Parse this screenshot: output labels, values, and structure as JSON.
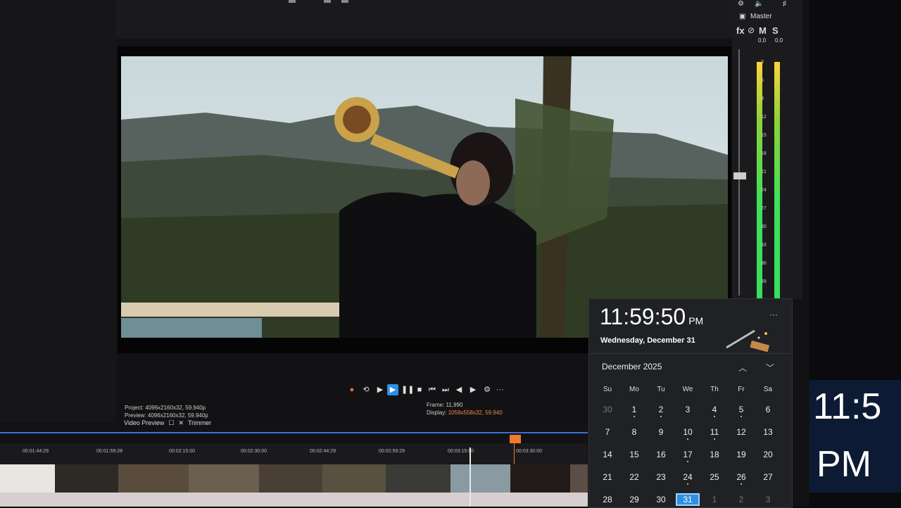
{
  "preview": {
    "project": "Project: 4096x2160x32, 59.940p",
    "preview_res": "Preview: 4096x2160x32, 59.940p",
    "frame": "Frame: 11,990",
    "display_label": "Display:",
    "display_value": "1059x558x32, 59.940"
  },
  "tabs": [
    "Video Preview",
    "Trimmer"
  ],
  "timeline": {
    "timecodes": [
      "00:01:44:29",
      "00:01:59:28",
      "00:02:15:00",
      "00:02:30:00",
      "00:02:44:29",
      "00:02:59:29",
      "00:03:15:00",
      "00:03:30:00"
    ]
  },
  "meters": {
    "title": "Master",
    "fx": "fx",
    "m": "M",
    "s": "S",
    "peak_left": "0.0",
    "peak_right": "0.0",
    "scale": [
      "3",
      "6",
      "9",
      "12",
      "15",
      "18",
      "21",
      "24",
      "27",
      "30",
      "33",
      "36",
      "39"
    ]
  },
  "clock": {
    "time": "11:59:50",
    "ampm": "PM",
    "date": "Wednesday, December 31",
    "more": "···"
  },
  "calendar": {
    "month": "December 2025",
    "dow": [
      "Su",
      "Mo",
      "Tu",
      "We",
      "Th",
      "Fr",
      "Sa"
    ],
    "weeks": [
      [
        "30",
        "1",
        "2",
        "3",
        "4",
        "5",
        "6"
      ],
      [
        "7",
        "8",
        "9",
        "10",
        "11",
        "12",
        "13"
      ],
      [
        "14",
        "15",
        "16",
        "17",
        "18",
        "19",
        "20"
      ],
      [
        "21",
        "22",
        "23",
        "24",
        "25",
        "26",
        "27"
      ],
      [
        "28",
        "29",
        "30",
        "31",
        "1",
        "2",
        "3"
      ]
    ],
    "today": "31"
  },
  "second_monitor": {
    "time": "11:5",
    "ampm": "PM"
  }
}
